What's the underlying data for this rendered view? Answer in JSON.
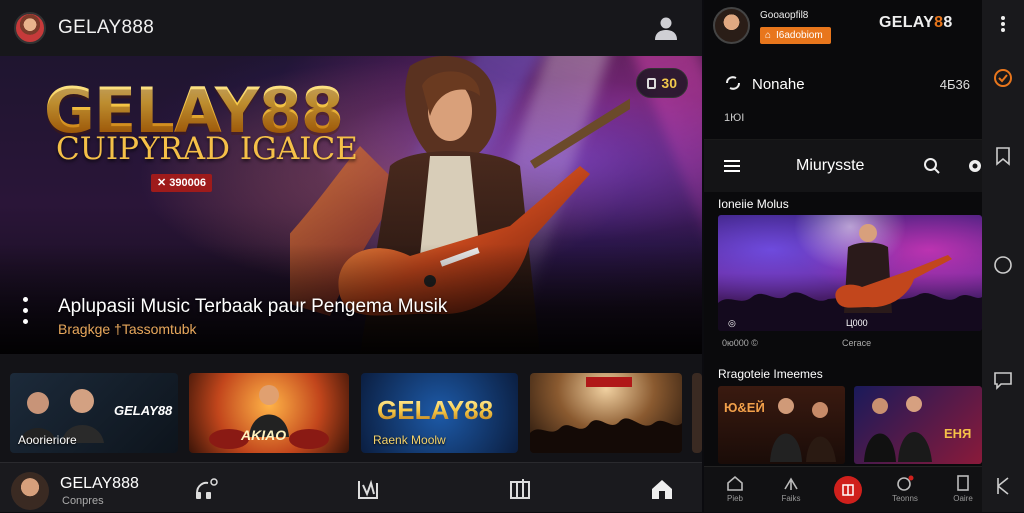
{
  "header": {
    "brand": "GELAY888"
  },
  "hero": {
    "title": "GELAY88",
    "subtitle": "CUIPYRAD IGAICE",
    "badge": "✕ 390006",
    "pill_value": "30",
    "caption": "Aplupasii Music Terbaak paur Pengema Musik",
    "caption_sub": "Bragkge †Tassomtubk"
  },
  "thumbnails": [
    {
      "label": "Aoorieriore",
      "logo": "GELAY88"
    },
    {
      "label": "",
      "logo": "AKIAO"
    },
    {
      "label": "Raenk Moolw",
      "logo": "GELAY88"
    },
    {
      "label": "",
      "logo": ""
    }
  ],
  "bottom_bar": {
    "name": "GELAY888",
    "sub": "Conpres"
  },
  "right": {
    "user_name": "Gooaopfil8",
    "user_badge": "I6adobiom",
    "brand_main": "GELAY",
    "brand_accent": "8",
    "brand_tail": "8",
    "row_name": "Nonahe",
    "row_count": "4Б36",
    "row_sub": "1ЮI",
    "nav_title": "Miurysste",
    "section1_title": "Ioneiie Molus",
    "video_tag": "Ц000",
    "video_meta_left": "0ю000 ©",
    "video_meta_right": "Ceгаcе",
    "section2_title": "Rragoteie Imeemes",
    "card1_logo": "Ю&ЕЙ",
    "card2_logo": "ЕНЯ",
    "tabs": [
      {
        "label": "Pieb"
      },
      {
        "label": "Faiks"
      },
      {
        "label": ""
      },
      {
        "label": "Teonns"
      },
      {
        "label": "Oaire"
      }
    ]
  },
  "colors": {
    "accent_orange": "#e8761c",
    "gold": "#f7c948",
    "record_red": "#d0201c"
  },
  "icons": {
    "user": "user-icon",
    "menu": "menu-icon",
    "search": "search-icon",
    "settings": "gear-icon",
    "record": "record-icon"
  }
}
